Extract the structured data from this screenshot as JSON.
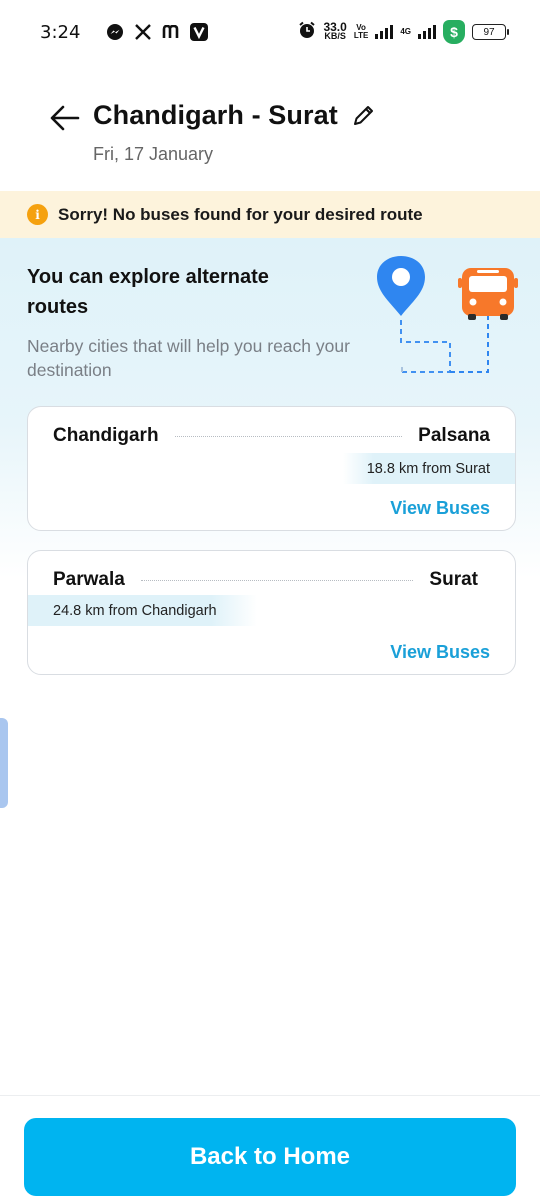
{
  "status_bar": {
    "time": "3:24",
    "app_icons": [
      "messenger-icon",
      "x-icon",
      "m-icon",
      "v-icon"
    ],
    "net_speed_value": "33.0",
    "net_speed_unit": "KB/S",
    "volte_top": "Vo",
    "volte_bottom": "LTE",
    "network_type": "4G",
    "battery": "97"
  },
  "header": {
    "title": "Chandigarh - Surat",
    "date": "Fri, 17 January"
  },
  "alert": {
    "icon_text": "i",
    "message": "Sorry! No buses found for your desired route"
  },
  "explore": {
    "title": "You can explore alternate routes",
    "subtitle": "Nearby cities that will help you reach your destination"
  },
  "routes": [
    {
      "from": "Chandigarh",
      "to": "Palsana",
      "distance_note": "18.8 km from Surat",
      "note_side": "right",
      "action": "View Buses"
    },
    {
      "from": "Parwala",
      "to": "Surat",
      "distance_note": "24.8 km from Chandigarh",
      "note_side": "left",
      "action": "View Buses"
    }
  ],
  "footer": {
    "button_label": "Back to Home"
  },
  "colors": {
    "primary": "#00b4f0",
    "link": "#1aa0d8",
    "alert_bg": "#fdf3dc",
    "alert_icon": "#f5a10f",
    "explore_bg": "#dff2f9",
    "bus_orange": "#f7782a",
    "pin_blue": "#2f86f0"
  }
}
